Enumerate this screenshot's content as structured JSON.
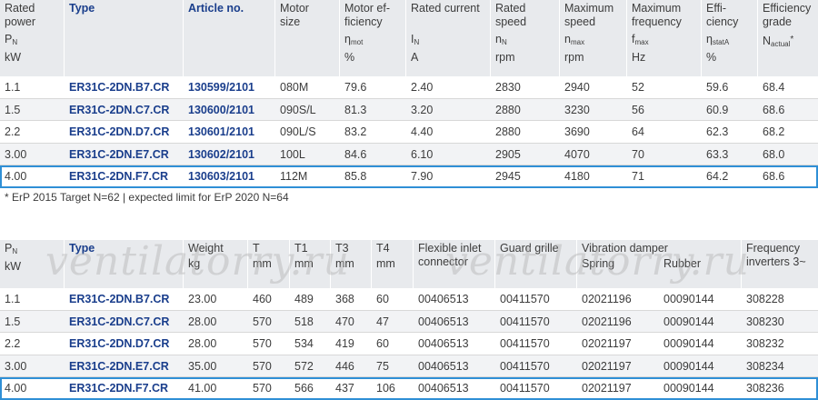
{
  "table1": {
    "headers": {
      "rated_power": [
        "Rated",
        "power",
        "P",
        "N",
        "kW"
      ],
      "type": "Type",
      "article": "Article no.",
      "motor_size": [
        "Motor",
        "size"
      ],
      "motor_eff": [
        "Motor ef-",
        "ficiency",
        "η",
        "mot",
        "%"
      ],
      "rated_current": [
        "Rated current",
        "I",
        "N",
        "A"
      ],
      "rated_speed": [
        "Rated",
        "speed",
        "n",
        "N",
        "rpm"
      ],
      "max_speed": [
        "Maximum",
        "speed",
        "n",
        "max",
        "rpm"
      ],
      "max_freq": [
        "Maximum",
        "frequency",
        "f",
        "max",
        "Hz"
      ],
      "efficiency": [
        "Effi-",
        "ciency",
        "η",
        "statA",
        "%"
      ],
      "eff_grade": [
        "Efficiency",
        "grade",
        "N",
        "actual",
        "*"
      ]
    },
    "rows": [
      {
        "p": "1.1",
        "type": "ER31C-2DN.B7.CR",
        "article": "130599/2101",
        "motor": "080M",
        "meff": "79.6",
        "current": "2.40",
        "rspeed": "2830",
        "mspeed": "2940",
        "mfreq": "52",
        "eff": "59.6",
        "grade": "68.4"
      },
      {
        "p": "1.5",
        "type": "ER31C-2DN.C7.CR",
        "article": "130600/2101",
        "motor": "090S/L",
        "meff": "81.3",
        "current": "3.20",
        "rspeed": "2880",
        "mspeed": "3230",
        "mfreq": "56",
        "eff": "60.9",
        "grade": "68.6"
      },
      {
        "p": "2.2",
        "type": "ER31C-2DN.D7.CR",
        "article": "130601/2101",
        "motor": "090L/S",
        "meff": "83.2",
        "current": "4.40",
        "rspeed": "2880",
        "mspeed": "3690",
        "mfreq": "64",
        "eff": "62.3",
        "grade": "68.2"
      },
      {
        "p": "3.00",
        "type": "ER31C-2DN.E7.CR",
        "article": "130602/2101",
        "motor": "100L",
        "meff": "84.6",
        "current": "6.10",
        "rspeed": "2905",
        "mspeed": "4070",
        "mfreq": "70",
        "eff": "63.3",
        "grade": "68.0"
      },
      {
        "p": "4.00",
        "type": "ER31C-2DN.F7.CR",
        "article": "130603/2101",
        "motor": "112M",
        "meff": "85.8",
        "current": "7.90",
        "rspeed": "2945",
        "mspeed": "4180",
        "mfreq": "71",
        "eff": "64.2",
        "grade": "68.6"
      }
    ]
  },
  "note": "* ErP 2015 Target N=62 | expected limit for ErP 2020 N=64",
  "table2": {
    "headers": {
      "p": [
        "P",
        "N",
        "kW"
      ],
      "type": "Type",
      "weight": [
        "Weight",
        "kg"
      ],
      "t": [
        "T",
        "mm"
      ],
      "t1": [
        "T1",
        "mm"
      ],
      "t3": [
        "T3",
        "mm"
      ],
      "t4": [
        "T4",
        "mm"
      ],
      "inlet": [
        "Flexible inlet",
        "connector"
      ],
      "grille": "Guard grille",
      "damper": [
        "Vibration damper",
        "Spring",
        "Rubber"
      ],
      "freq": [
        "Frequency",
        "inverters 3~"
      ]
    },
    "rows": [
      {
        "p": "1.1",
        "type": "ER31C-2DN.B7.CR",
        "weight": "23.00",
        "t": "460",
        "t1": "489",
        "t3": "368",
        "t4": "60",
        "inlet": "00406513",
        "grille": "00411570",
        "spring": "02021196",
        "rubber": "00090144",
        "freq": "308228"
      },
      {
        "p": "1.5",
        "type": "ER31C-2DN.C7.CR",
        "weight": "28.00",
        "t": "570",
        "t1": "518",
        "t3": "470",
        "t4": "47",
        "inlet": "00406513",
        "grille": "00411570",
        "spring": "02021196",
        "rubber": "00090144",
        "freq": "308230"
      },
      {
        "p": "2.2",
        "type": "ER31C-2DN.D7.CR",
        "weight": "28.00",
        "t": "570",
        "t1": "534",
        "t3": "419",
        "t4": "60",
        "inlet": "00406513",
        "grille": "00411570",
        "spring": "02021197",
        "rubber": "00090144",
        "freq": "308232"
      },
      {
        "p": "3.00",
        "type": "ER31C-2DN.E7.CR",
        "weight": "35.00",
        "t": "570",
        "t1": "572",
        "t3": "446",
        "t4": "75",
        "inlet": "00406513",
        "grille": "00411570",
        "spring": "02021197",
        "rubber": "00090144",
        "freq": "308234"
      },
      {
        "p": "4.00",
        "type": "ER31C-2DN.F7.CR",
        "weight": "41.00",
        "t": "570",
        "t1": "566",
        "t3": "437",
        "t4": "106",
        "inlet": "00406513",
        "grille": "00411570",
        "spring": "02021197",
        "rubber": "00090144",
        "freq": "308236"
      }
    ]
  },
  "watermark": "ventilatorry.ru",
  "colors": {
    "accent": "#2f8fd6",
    "link": "#1a3e8c",
    "header_bg": "#e8eaed"
  }
}
